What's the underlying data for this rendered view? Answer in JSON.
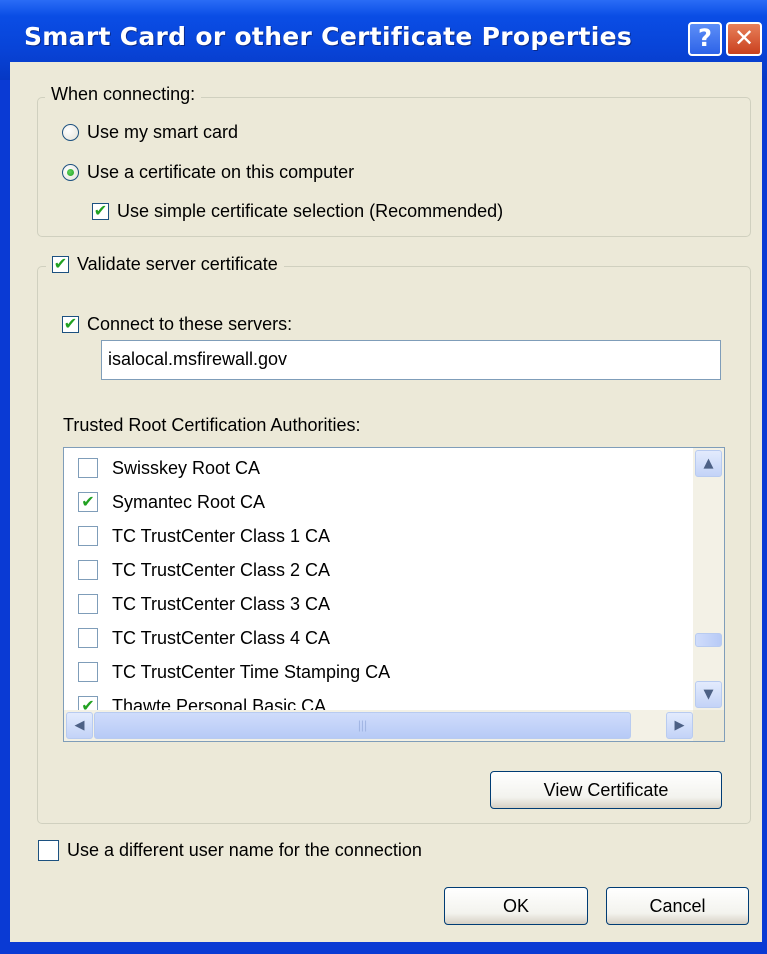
{
  "window": {
    "title": "Smart Card or other Certificate Properties",
    "help_glyph": "?",
    "close_glyph": "✕"
  },
  "when_connecting": {
    "legend": "When connecting:",
    "smart_card_label": "Use my smart card",
    "smart_card_selected": false,
    "certificate_label": "Use a certificate on this computer",
    "certificate_selected": true,
    "simple_selection_label": "Use simple certificate selection (Recommended)",
    "simple_selection_checked": true
  },
  "validate": {
    "legend": "Validate server certificate",
    "checked": true,
    "connect_label": "Connect to these servers:",
    "connect_checked": true,
    "servers_value": "isalocal.msfirewall.gov",
    "trusted_label": "Trusted Root Certification Authorities:",
    "authorities": [
      {
        "label": "Swisskey Root CA",
        "checked": false
      },
      {
        "label": "Symantec Root CA",
        "checked": true
      },
      {
        "label": "TC TrustCenter Class 1 CA",
        "checked": false
      },
      {
        "label": "TC TrustCenter Class 2 CA",
        "checked": false
      },
      {
        "label": "TC TrustCenter Class 3 CA",
        "checked": false
      },
      {
        "label": "TC TrustCenter Class 4 CA",
        "checked": false
      },
      {
        "label": "TC TrustCenter Time Stamping CA",
        "checked": false
      },
      {
        "label": "Thawte Personal Basic CA",
        "checked": true
      }
    ],
    "view_certificate_label": "View Certificate"
  },
  "different_user": {
    "label": "Use a different user name for the connection",
    "checked": false
  },
  "buttons": {
    "ok_label": "OK",
    "cancel_label": "Cancel"
  },
  "icons": {
    "check_glyph": "✔",
    "scroll_up": "▲",
    "scroll_down": "▼",
    "scroll_left": "◀",
    "scroll_right": "▶",
    "grip": "|||"
  }
}
